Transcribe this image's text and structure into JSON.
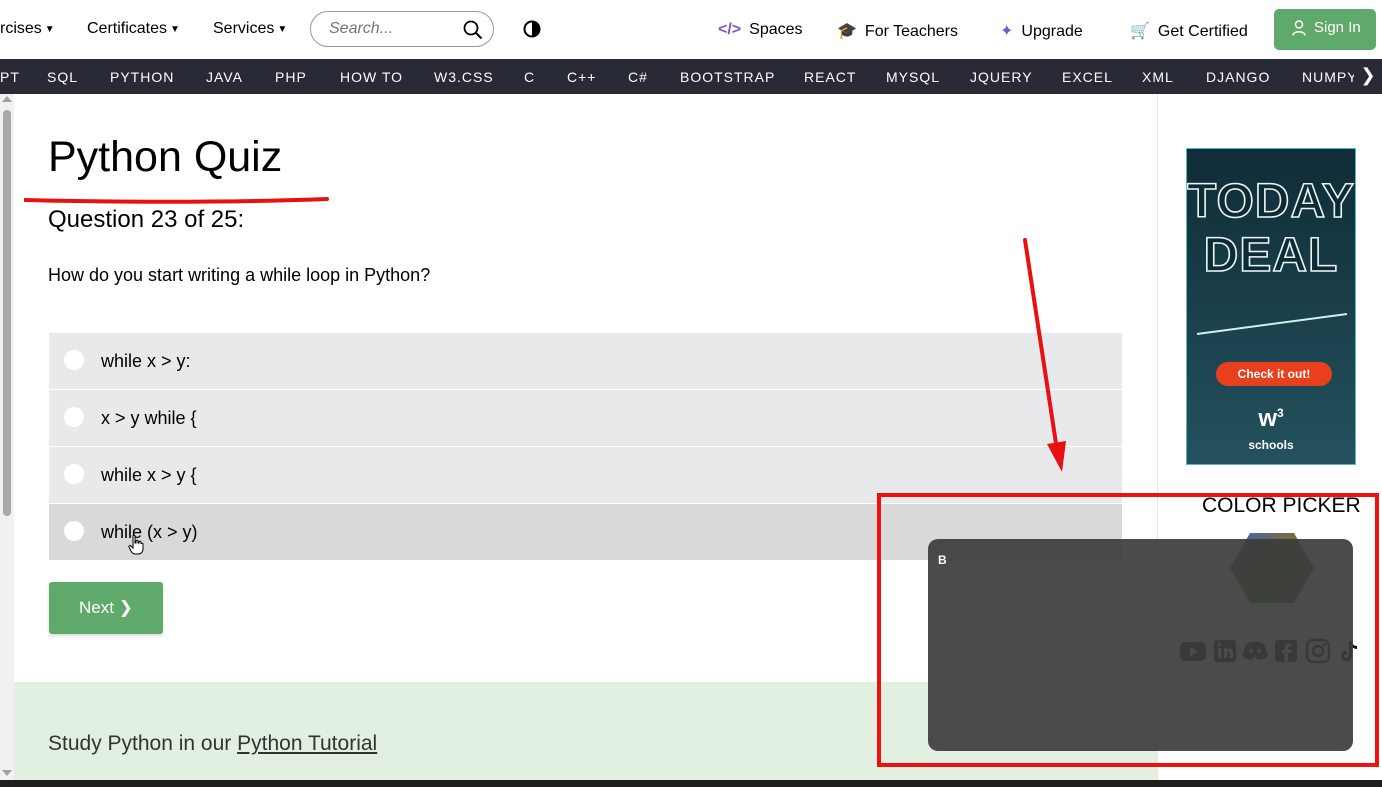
{
  "topnav": {
    "items": [
      {
        "label": "rcises",
        "dropdown": true
      },
      {
        "label": "Certificates",
        "dropdown": true
      },
      {
        "label": "Services",
        "dropdown": true
      }
    ],
    "search_placeholder": "Search...",
    "right_links": [
      {
        "label": "Spaces",
        "icon": "code-icon"
      },
      {
        "label": "For Teachers",
        "icon": "graduation-cap-icon"
      },
      {
        "label": "Upgrade",
        "icon": "sparkle-icon"
      },
      {
        "label": "Get Certified",
        "icon": "cart-icon"
      }
    ],
    "signin_label": "Sign In",
    "accent": "#5faa6a"
  },
  "subnav": {
    "items": [
      "PT",
      "SQL",
      "PYTHON",
      "JAVA",
      "PHP",
      "HOW TO",
      "W3.CSS",
      "C",
      "C++",
      "C#",
      "BOOTSTRAP",
      "REACT",
      "MYSQL",
      "JQUERY",
      "EXCEL",
      "XML",
      "DJANGO",
      "NUMPY"
    ],
    "next_arrow": "❯",
    "background": "#282a35"
  },
  "quiz": {
    "title": "Python Quiz",
    "question_number": "Question 23 of 25:",
    "question": "How do you start writing a while loop in Python?",
    "options": [
      "while x > y:",
      "x > y while {",
      "while x > y {",
      "while (x > y)"
    ],
    "hovered_option": 3,
    "next_label": "Next ❯"
  },
  "study": {
    "prefix": "Study Python in our ",
    "link": "Python Tutorial"
  },
  "sidebar": {
    "ad": {
      "title_line1": "TODAY'S",
      "title_line2": "DEAL",
      "button": "Check it out!",
      "logo": "w",
      "logo_sup": "3",
      "logo_sub": "schools"
    },
    "color_picker_title": "COLOR PICKER",
    "social_icons": [
      "youtube-icon",
      "linkedin-icon",
      "discord-icon",
      "facebook-icon",
      "instagram-icon",
      "tiktok-icon"
    ]
  },
  "overlay": {
    "label": "B"
  },
  "annotation_color": "#f01010"
}
